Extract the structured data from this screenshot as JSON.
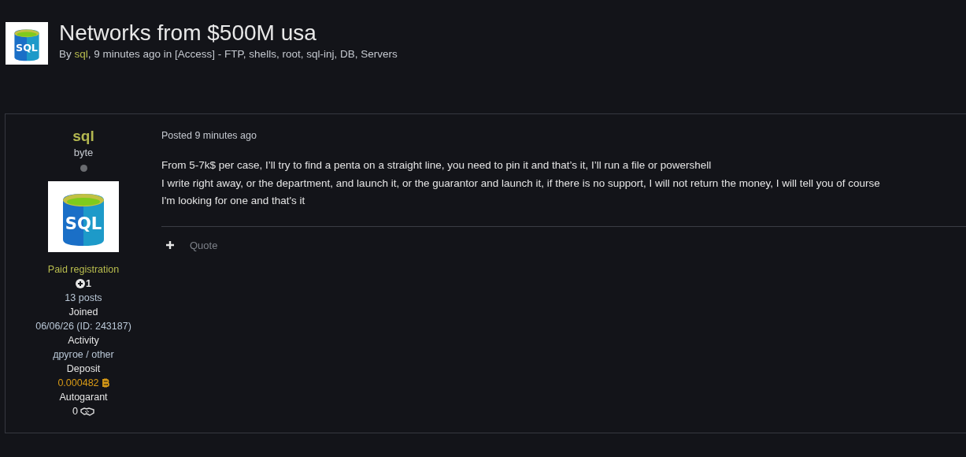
{
  "topic": {
    "icon_label": "SQL",
    "title": "Networks from $500M usa",
    "byline_prefix": "By",
    "author": "sql",
    "byline_rest": ", 9 minutes ago in [Access] - FTP, shells, root, sql-inj, DB, Servers"
  },
  "post": {
    "author": {
      "name": "sql",
      "rank": "byte",
      "online": false,
      "avatar_label": "SQL",
      "group": "Paid registration",
      "reputation": "1",
      "posts": "13 posts",
      "fields": [
        {
          "kind": "label",
          "text": "Joined"
        },
        {
          "kind": "value",
          "text": "06/06/26 (ID: 243187)"
        },
        {
          "kind": "label",
          "text": "Activity"
        },
        {
          "kind": "value",
          "text": "другое / other"
        },
        {
          "kind": "label",
          "text": "Deposit"
        },
        {
          "kind": "deposit",
          "text": "0.000482"
        },
        {
          "kind": "label",
          "text": "Autogarant"
        },
        {
          "kind": "deals",
          "text": "0"
        }
      ]
    },
    "posted": "Posted 9 minutes ago",
    "lines": [
      "From 5-7k$ per case, I’ll try to find a penta on a straight line, you need to pin it and that’s it, I’ll run a file or powershell",
      "I write right away, or the department, and launch it, or the guarantor and launch it, if there is no support, I will not return the money, I will tell you of course",
      "I'm looking for one and that's it"
    ],
    "actions": [
      {
        "kind": "plus"
      },
      {
        "kind": "quote",
        "label": "Quote"
      }
    ]
  }
}
